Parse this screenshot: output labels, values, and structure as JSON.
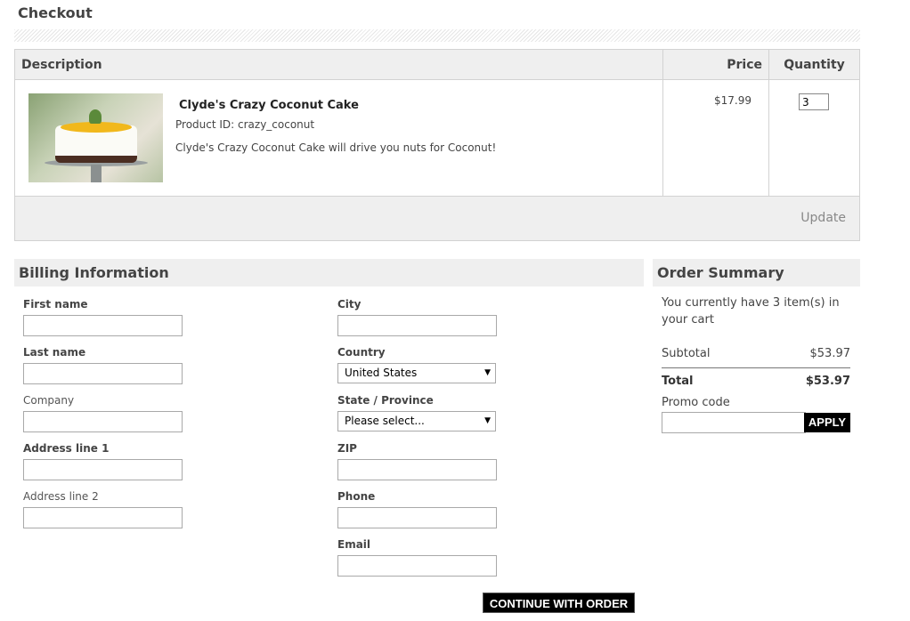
{
  "page": {
    "title": "Checkout"
  },
  "cart": {
    "headers": {
      "description": "Description",
      "price": "Price",
      "quantity": "Quantity"
    },
    "item": {
      "name": "Clyde's Crazy Coconut Cake",
      "product_id": "Product ID: crazy_coconut",
      "description": "Clyde's Crazy Coconut Cake will drive you nuts for Coconut!",
      "price": "$17.99",
      "quantity": "3",
      "image": "coconut-cake-photo"
    },
    "update_label": "Update"
  },
  "billing": {
    "title": "Billing Information",
    "fields": {
      "first_name": "First name",
      "last_name": "Last name",
      "company": "Company",
      "address1": "Address line 1",
      "address2": "Address line 2",
      "city": "City",
      "country": "Country",
      "country_value": "United States",
      "state": "State / Province",
      "state_value": "Please select...",
      "zip": "ZIP",
      "phone": "Phone",
      "email": "Email"
    },
    "continue_label": "CONTINUE WITH ORDER"
  },
  "summary": {
    "title": "Order Summary",
    "cart_text": "You currently have 3 item(s) in your cart",
    "subtotal_label": "Subtotal",
    "subtotal_value": "$53.97",
    "total_label": "Total",
    "total_value": "$53.97",
    "promo_label": "Promo code",
    "apply_label": "APPLY"
  },
  "icons": {
    "dropdown": "chevron-down-icon"
  }
}
